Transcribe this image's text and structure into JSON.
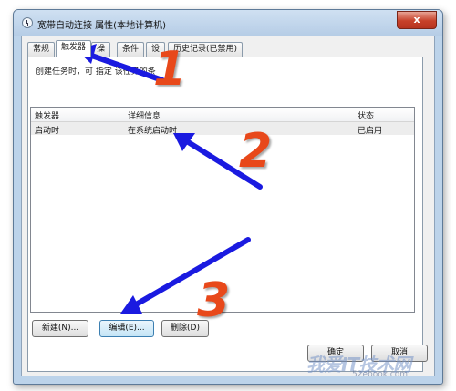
{
  "window": {
    "title": "宽带自动连接 属性(本地计算机)",
    "close_glyph": "x"
  },
  "tabs": [
    {
      "label": "常规",
      "active": false
    },
    {
      "label": "触发器",
      "active": true
    },
    {
      "label": "操",
      "active": false
    },
    {
      "label": "条件",
      "active": false
    },
    {
      "label": "设",
      "active": false
    },
    {
      "label": "历史记录(已禁用)",
      "active": false
    }
  ],
  "triggers": {
    "description": "创建任务时，可    指定      该任务的条",
    "columns": [
      "触发器",
      "详细信息",
      "状态"
    ],
    "rows": [
      {
        "trigger": "启动时",
        "details": "在系统启动时",
        "status": "已启用"
      }
    ]
  },
  "buttons": {
    "new": "新建(N)...",
    "edit": "编辑(E)...",
    "delete": "删除(D)",
    "ok": "确定",
    "cancel": "取消"
  },
  "annotations": {
    "step1": "1",
    "step2": "2",
    "step3": "3",
    "arrow_color": "#1a1ae0",
    "number_color": "#e8481a"
  },
  "watermark": {
    "brand": "我爱IT技术网",
    "url": "52ebook.com"
  }
}
